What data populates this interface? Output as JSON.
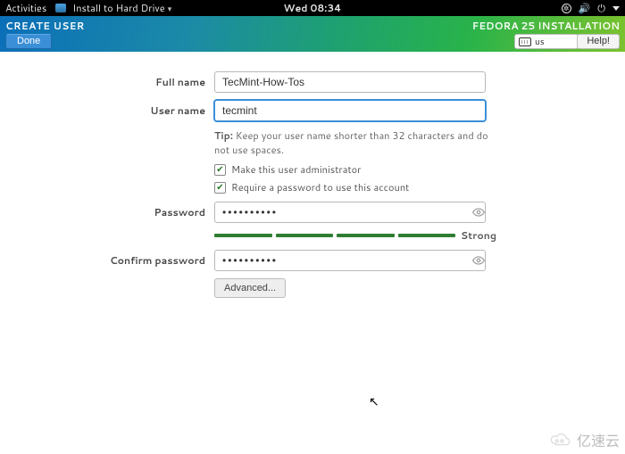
{
  "topbar": {
    "activities": "Activities",
    "app": "Install to Hard Drive",
    "clock": "Wed 08:34"
  },
  "header": {
    "title": "CREATE USER",
    "installation": "FEDORA 25 INSTALLATION",
    "done": "Done",
    "help": "Help!",
    "keyboard": "us"
  },
  "form": {
    "fullname_label": "Full name",
    "fullname_value": "TecMint-How-Tos",
    "username_label": "User name",
    "username_value": "tecmint",
    "tip_prefix": "Tip:",
    "tip_text": " Keep your user name shorter than 32 characters and do not use spaces.",
    "admin_label": "Make this user administrator",
    "requirepw_label": "Require a password to use this account",
    "password_label": "Password",
    "password_value": "••••••••••",
    "strength_label": "Strong",
    "confirm_label": "Confirm password",
    "confirm_value": "••••••••••",
    "advanced": "Advanced..."
  },
  "watermark": "亿速云"
}
